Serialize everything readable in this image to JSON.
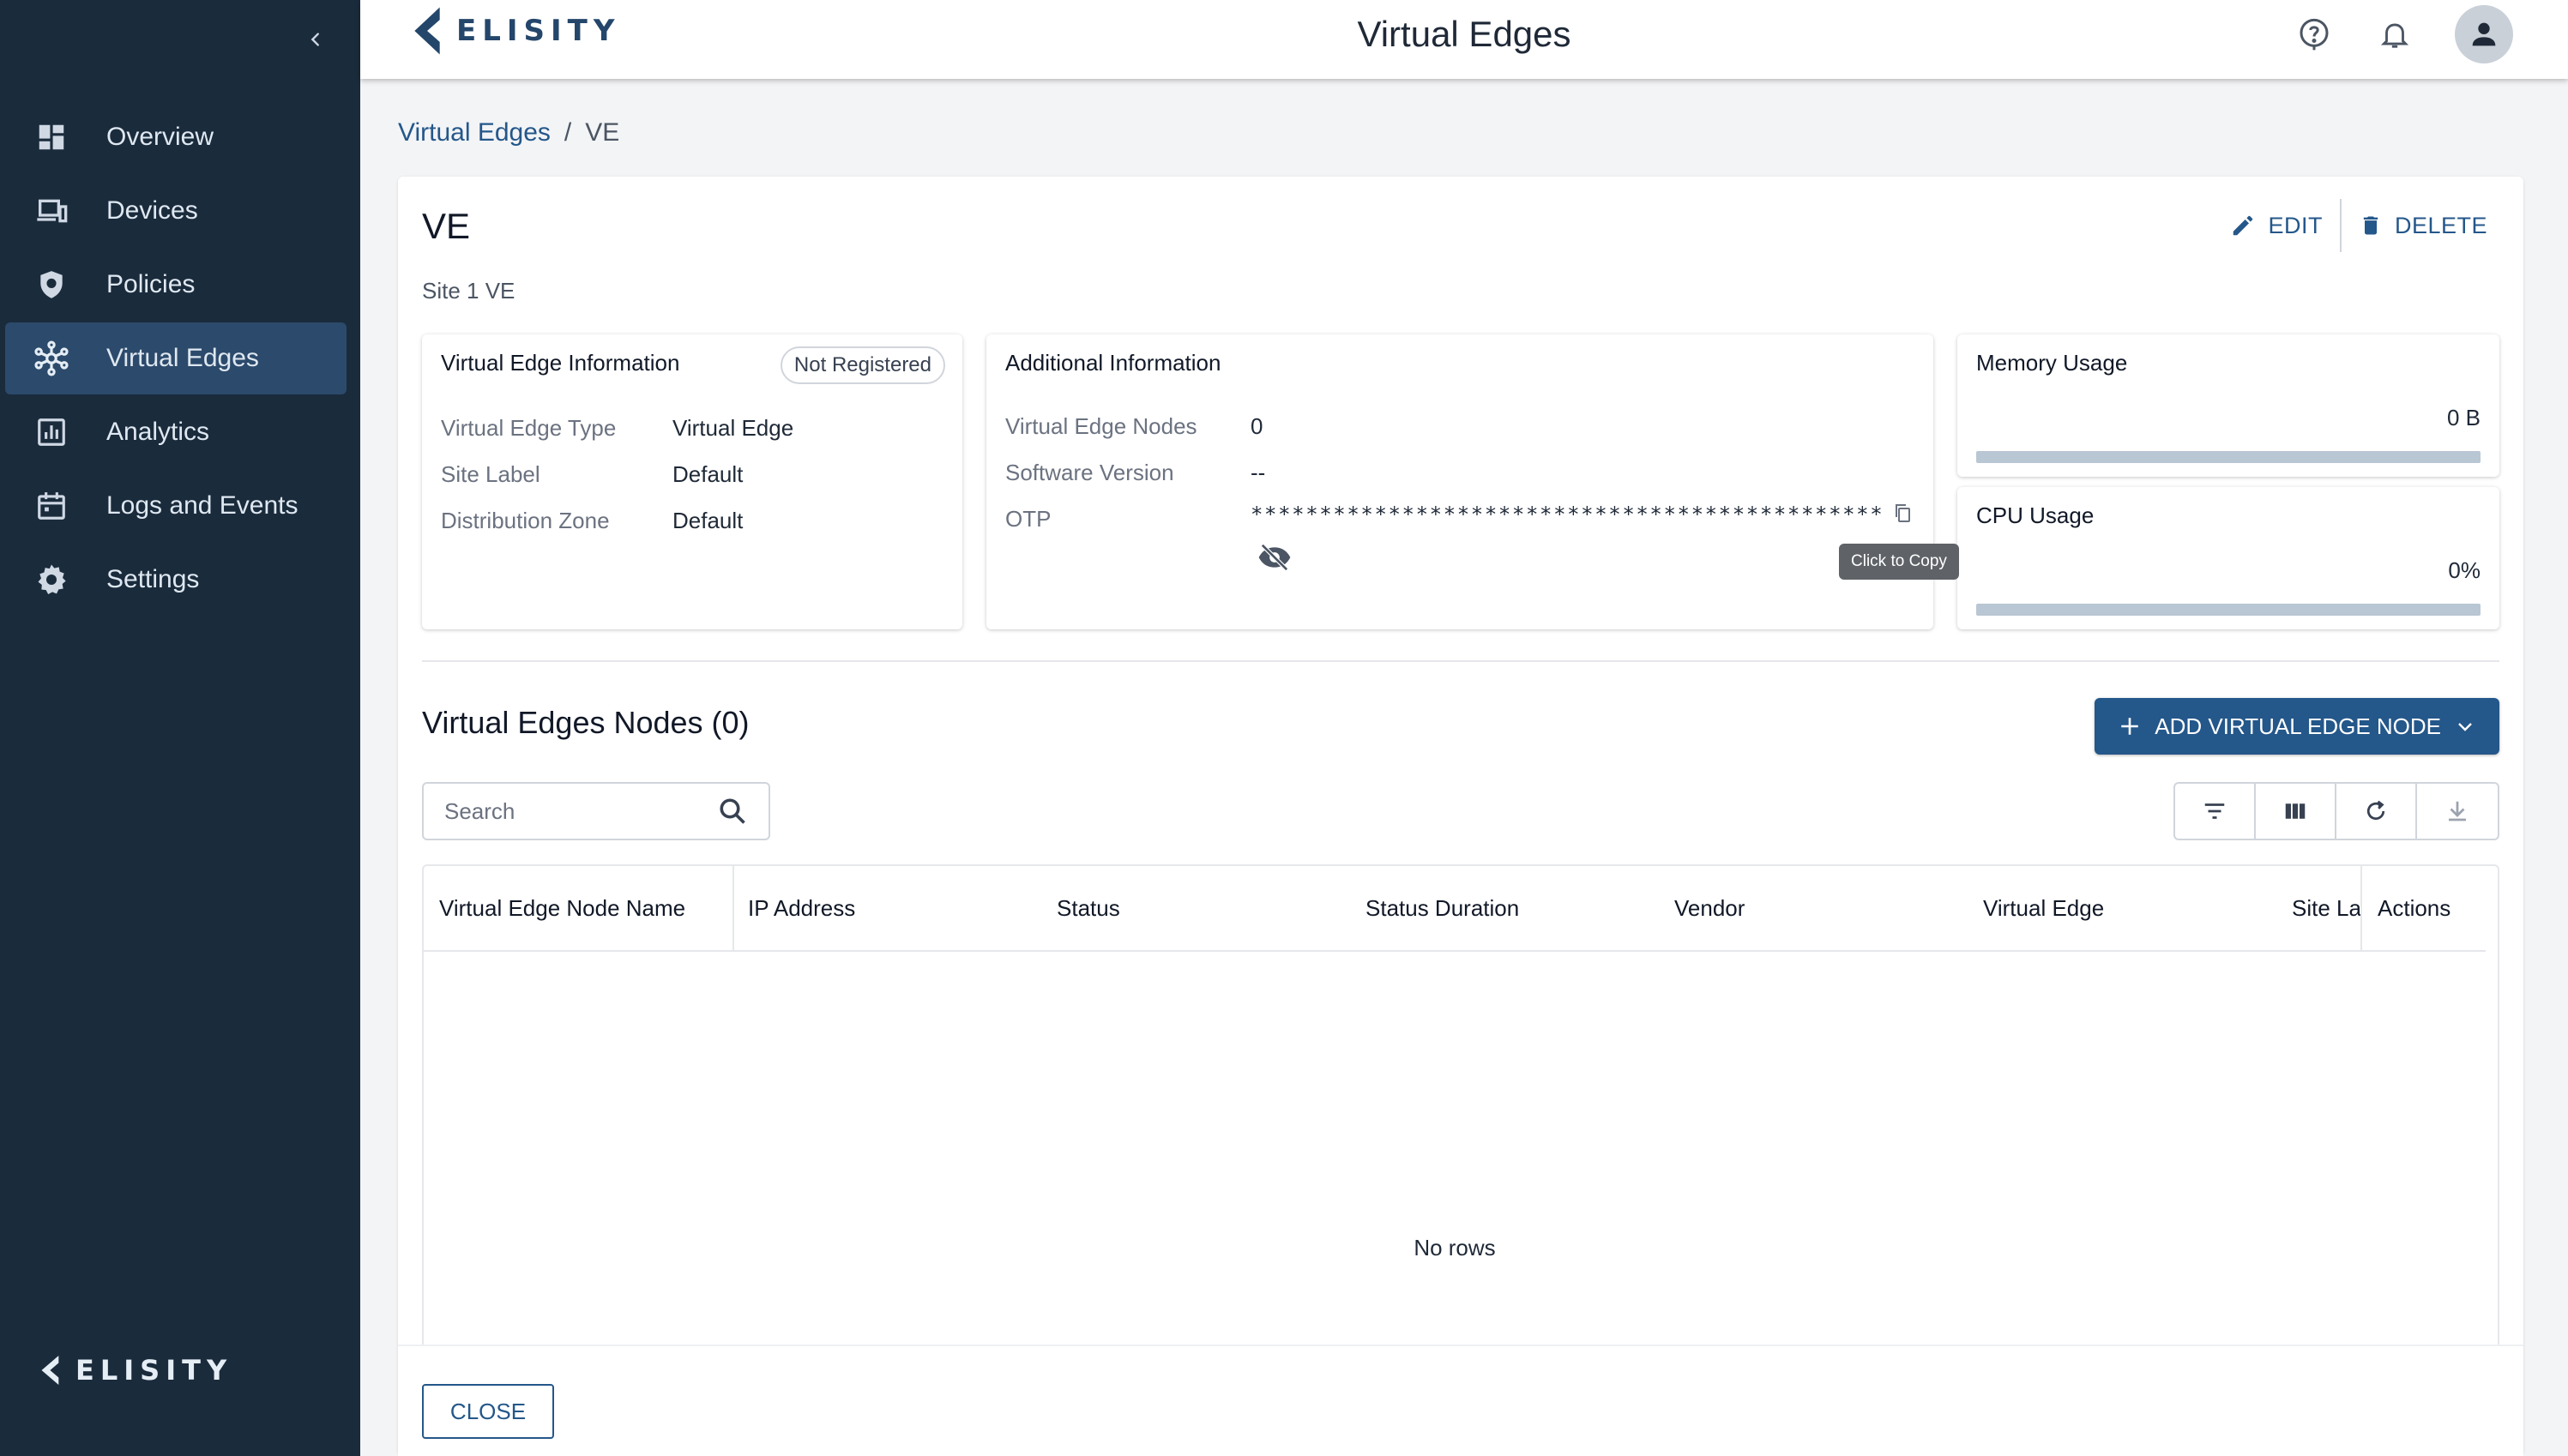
{
  "header": {
    "title": "Virtual Edges",
    "logo_text": "ELISITY"
  },
  "sidebar": {
    "items": [
      {
        "label": "Overview",
        "icon": "dashboard-icon"
      },
      {
        "label": "Devices",
        "icon": "devices-icon"
      },
      {
        "label": "Policies",
        "icon": "shield-icon"
      },
      {
        "label": "Virtual Edges",
        "icon": "hub-icon",
        "active": true
      },
      {
        "label": "Analytics",
        "icon": "chart-icon"
      },
      {
        "label": "Logs and Events",
        "icon": "calendar-icon"
      },
      {
        "label": "Settings",
        "icon": "gear-icon"
      }
    ],
    "footer_logo_text": "ELISITY"
  },
  "breadcrumb": {
    "parent": "Virtual Edges",
    "separator": "/",
    "current": "VE"
  },
  "detail": {
    "name": "VE",
    "description": "Site 1 VE",
    "edit_label": "EDIT",
    "delete_label": "DELETE"
  },
  "info_card": {
    "title": "Virtual Edge Information",
    "status": "Not Registered",
    "rows": [
      {
        "key": "Virtual Edge Type",
        "value": "Virtual Edge"
      },
      {
        "key": "Site Label",
        "value": "Default"
      },
      {
        "key": "Distribution Zone",
        "value": "Default"
      }
    ]
  },
  "additional_card": {
    "title": "Additional Information",
    "rows": [
      {
        "key": "Virtual Edge Nodes",
        "value": "0"
      },
      {
        "key": "Software Version",
        "value": "--"
      },
      {
        "key": "OTP",
        "value": "**********************************************"
      }
    ],
    "copy_tooltip": "Click to Copy"
  },
  "memory_card": {
    "title": "Memory Usage",
    "value": "0 B",
    "fill_percent": 0
  },
  "cpu_card": {
    "title": "CPU Usage",
    "value": "0%",
    "fill_percent": 0
  },
  "nodes": {
    "title": "Virtual Edges Nodes (0)",
    "add_button_label": "ADD VIRTUAL EDGE NODE",
    "search_placeholder": "Search",
    "columns": [
      "Virtual Edge Node Name",
      "IP Address",
      "Status",
      "Status Duration",
      "Vendor",
      "Virtual Edge",
      "Site La",
      "Actions"
    ],
    "empty_text": "No rows"
  },
  "footer": {
    "close_label": "CLOSE"
  },
  "colors": {
    "sidebar_bg": "#1a2b3c",
    "sidebar_active": "#2c4a6b",
    "accent": "#24578a"
  }
}
